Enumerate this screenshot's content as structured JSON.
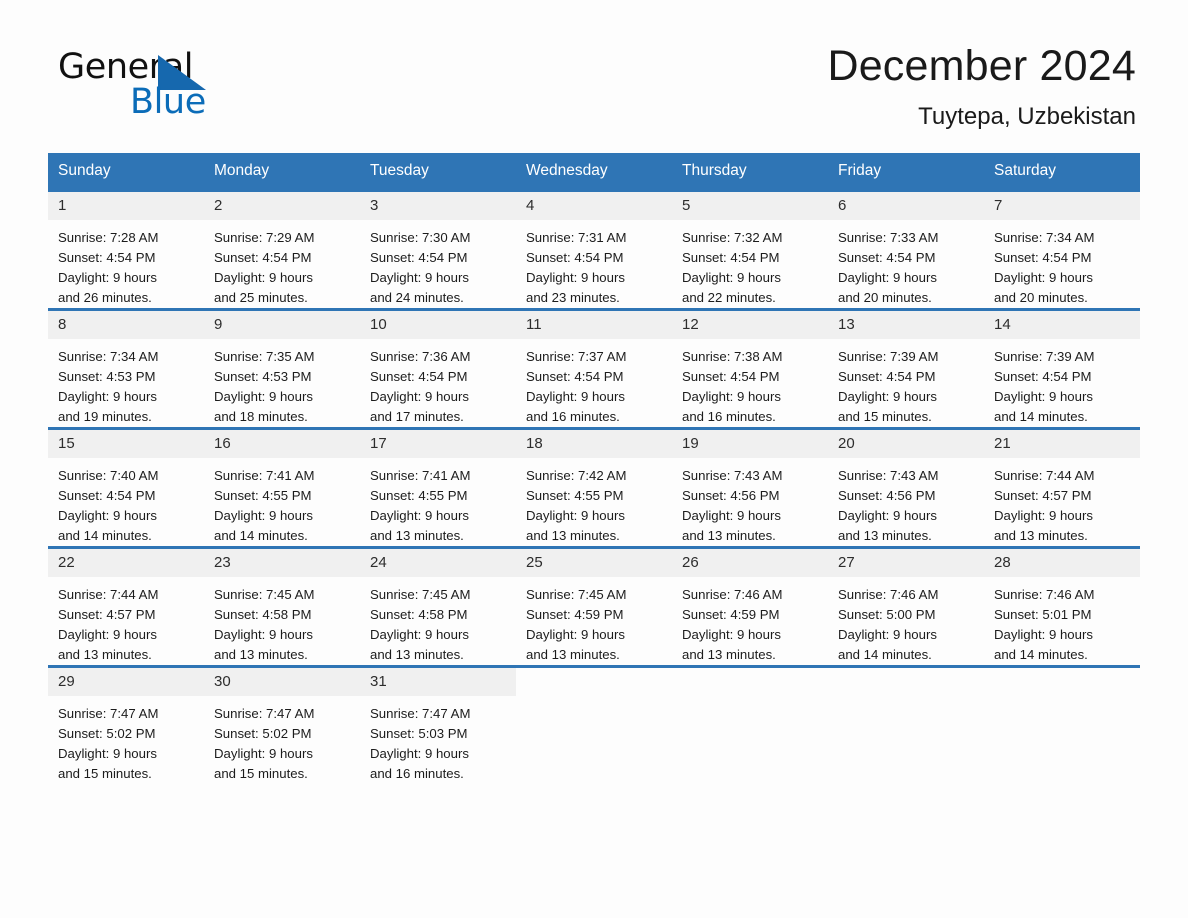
{
  "brand": {
    "name_part1": "General",
    "name_part2": "Blue",
    "logo_icon": "blue-triangle-icon",
    "accent_color": "#0b6cb8"
  },
  "header": {
    "title": "December 2024",
    "location": "Tuytepa, Uzbekistan"
  },
  "theme": {
    "header_row_color": "#2f75b5",
    "daynum_band_color": "#f0f0f0",
    "page_background": "#fdfdfd",
    "text_color": "#1a1a1a"
  },
  "calendar": {
    "weekday_headers": [
      "Sunday",
      "Monday",
      "Tuesday",
      "Wednesday",
      "Thursday",
      "Friday",
      "Saturday"
    ],
    "weeks": [
      [
        {
          "day": "1",
          "sunrise": "Sunrise: 7:28 AM",
          "sunset": "Sunset: 4:54 PM",
          "daylight_line1": "Daylight: 9 hours",
          "daylight_line2": "and 26 minutes."
        },
        {
          "day": "2",
          "sunrise": "Sunrise: 7:29 AM",
          "sunset": "Sunset: 4:54 PM",
          "daylight_line1": "Daylight: 9 hours",
          "daylight_line2": "and 25 minutes."
        },
        {
          "day": "3",
          "sunrise": "Sunrise: 7:30 AM",
          "sunset": "Sunset: 4:54 PM",
          "daylight_line1": "Daylight: 9 hours",
          "daylight_line2": "and 24 minutes."
        },
        {
          "day": "4",
          "sunrise": "Sunrise: 7:31 AM",
          "sunset": "Sunset: 4:54 PM",
          "daylight_line1": "Daylight: 9 hours",
          "daylight_line2": "and 23 minutes."
        },
        {
          "day": "5",
          "sunrise": "Sunrise: 7:32 AM",
          "sunset": "Sunset: 4:54 PM",
          "daylight_line1": "Daylight: 9 hours",
          "daylight_line2": "and 22 minutes."
        },
        {
          "day": "6",
          "sunrise": "Sunrise: 7:33 AM",
          "sunset": "Sunset: 4:54 PM",
          "daylight_line1": "Daylight: 9 hours",
          "daylight_line2": "and 20 minutes."
        },
        {
          "day": "7",
          "sunrise": "Sunrise: 7:34 AM",
          "sunset": "Sunset: 4:54 PM",
          "daylight_line1": "Daylight: 9 hours",
          "daylight_line2": "and 20 minutes."
        }
      ],
      [
        {
          "day": "8",
          "sunrise": "Sunrise: 7:34 AM",
          "sunset": "Sunset: 4:53 PM",
          "daylight_line1": "Daylight: 9 hours",
          "daylight_line2": "and 19 minutes."
        },
        {
          "day": "9",
          "sunrise": "Sunrise: 7:35 AM",
          "sunset": "Sunset: 4:53 PM",
          "daylight_line1": "Daylight: 9 hours",
          "daylight_line2": "and 18 minutes."
        },
        {
          "day": "10",
          "sunrise": "Sunrise: 7:36 AM",
          "sunset": "Sunset: 4:54 PM",
          "daylight_line1": "Daylight: 9 hours",
          "daylight_line2": "and 17 minutes."
        },
        {
          "day": "11",
          "sunrise": "Sunrise: 7:37 AM",
          "sunset": "Sunset: 4:54 PM",
          "daylight_line1": "Daylight: 9 hours",
          "daylight_line2": "and 16 minutes."
        },
        {
          "day": "12",
          "sunrise": "Sunrise: 7:38 AM",
          "sunset": "Sunset: 4:54 PM",
          "daylight_line1": "Daylight: 9 hours",
          "daylight_line2": "and 16 minutes."
        },
        {
          "day": "13",
          "sunrise": "Sunrise: 7:39 AM",
          "sunset": "Sunset: 4:54 PM",
          "daylight_line1": "Daylight: 9 hours",
          "daylight_line2": "and 15 minutes."
        },
        {
          "day": "14",
          "sunrise": "Sunrise: 7:39 AM",
          "sunset": "Sunset: 4:54 PM",
          "daylight_line1": "Daylight: 9 hours",
          "daylight_line2": "and 14 minutes."
        }
      ],
      [
        {
          "day": "15",
          "sunrise": "Sunrise: 7:40 AM",
          "sunset": "Sunset: 4:54 PM",
          "daylight_line1": "Daylight: 9 hours",
          "daylight_line2": "and 14 minutes."
        },
        {
          "day": "16",
          "sunrise": "Sunrise: 7:41 AM",
          "sunset": "Sunset: 4:55 PM",
          "daylight_line1": "Daylight: 9 hours",
          "daylight_line2": "and 14 minutes."
        },
        {
          "day": "17",
          "sunrise": "Sunrise: 7:41 AM",
          "sunset": "Sunset: 4:55 PM",
          "daylight_line1": "Daylight: 9 hours",
          "daylight_line2": "and 13 minutes."
        },
        {
          "day": "18",
          "sunrise": "Sunrise: 7:42 AM",
          "sunset": "Sunset: 4:55 PM",
          "daylight_line1": "Daylight: 9 hours",
          "daylight_line2": "and 13 minutes."
        },
        {
          "day": "19",
          "sunrise": "Sunrise: 7:43 AM",
          "sunset": "Sunset: 4:56 PM",
          "daylight_line1": "Daylight: 9 hours",
          "daylight_line2": "and 13 minutes."
        },
        {
          "day": "20",
          "sunrise": "Sunrise: 7:43 AM",
          "sunset": "Sunset: 4:56 PM",
          "daylight_line1": "Daylight: 9 hours",
          "daylight_line2": "and 13 minutes."
        },
        {
          "day": "21",
          "sunrise": "Sunrise: 7:44 AM",
          "sunset": "Sunset: 4:57 PM",
          "daylight_line1": "Daylight: 9 hours",
          "daylight_line2": "and 13 minutes."
        }
      ],
      [
        {
          "day": "22",
          "sunrise": "Sunrise: 7:44 AM",
          "sunset": "Sunset: 4:57 PM",
          "daylight_line1": "Daylight: 9 hours",
          "daylight_line2": "and 13 minutes."
        },
        {
          "day": "23",
          "sunrise": "Sunrise: 7:45 AM",
          "sunset": "Sunset: 4:58 PM",
          "daylight_line1": "Daylight: 9 hours",
          "daylight_line2": "and 13 minutes."
        },
        {
          "day": "24",
          "sunrise": "Sunrise: 7:45 AM",
          "sunset": "Sunset: 4:58 PM",
          "daylight_line1": "Daylight: 9 hours",
          "daylight_line2": "and 13 minutes."
        },
        {
          "day": "25",
          "sunrise": "Sunrise: 7:45 AM",
          "sunset": "Sunset: 4:59 PM",
          "daylight_line1": "Daylight: 9 hours",
          "daylight_line2": "and 13 minutes."
        },
        {
          "day": "26",
          "sunrise": "Sunrise: 7:46 AM",
          "sunset": "Sunset: 4:59 PM",
          "daylight_line1": "Daylight: 9 hours",
          "daylight_line2": "and 13 minutes."
        },
        {
          "day": "27",
          "sunrise": "Sunrise: 7:46 AM",
          "sunset": "Sunset: 5:00 PM",
          "daylight_line1": "Daylight: 9 hours",
          "daylight_line2": "and 14 minutes."
        },
        {
          "day": "28",
          "sunrise": "Sunrise: 7:46 AM",
          "sunset": "Sunset: 5:01 PM",
          "daylight_line1": "Daylight: 9 hours",
          "daylight_line2": "and 14 minutes."
        }
      ],
      [
        {
          "day": "29",
          "sunrise": "Sunrise: 7:47 AM",
          "sunset": "Sunset: 5:02 PM",
          "daylight_line1": "Daylight: 9 hours",
          "daylight_line2": "and 15 minutes."
        },
        {
          "day": "30",
          "sunrise": "Sunrise: 7:47 AM",
          "sunset": "Sunset: 5:02 PM",
          "daylight_line1": "Daylight: 9 hours",
          "daylight_line2": "and 15 minutes."
        },
        {
          "day": "31",
          "sunrise": "Sunrise: 7:47 AM",
          "sunset": "Sunset: 5:03 PM",
          "daylight_line1": "Daylight: 9 hours",
          "daylight_line2": "and 16 minutes."
        },
        {
          "day": "",
          "sunrise": "",
          "sunset": "",
          "daylight_line1": "",
          "daylight_line2": ""
        },
        {
          "day": "",
          "sunrise": "",
          "sunset": "",
          "daylight_line1": "",
          "daylight_line2": ""
        },
        {
          "day": "",
          "sunrise": "",
          "sunset": "",
          "daylight_line1": "",
          "daylight_line2": ""
        },
        {
          "day": "",
          "sunrise": "",
          "sunset": "",
          "daylight_line1": "",
          "daylight_line2": ""
        }
      ]
    ]
  }
}
